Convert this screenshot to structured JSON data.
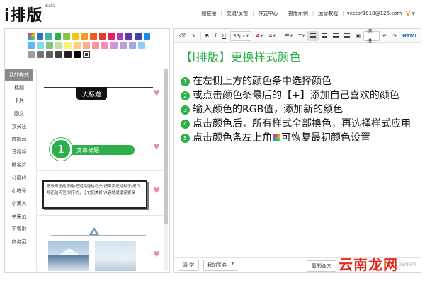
{
  "app": {
    "logo": "i排版",
    "beta": "Beta"
  },
  "topnav": {
    "items": [
      "超链接",
      "交流/反馈",
      "样式中心",
      "排版示例",
      "运营教程"
    ],
    "email": "vector1018@126.com",
    "vip_icon": "vip-badge-icon"
  },
  "palette": {
    "rows": [
      [
        "#2f6ec9",
        "#3fb5b0",
        "#2db04a",
        "#8bc34a",
        "#f5c518",
        "#f59c1a",
        "#ee5a24",
        "#e53935",
        "#e91e63",
        "#ad3bb5",
        "#5e35b1",
        "#3949ab",
        "#1e88e5"
      ],
      [
        "#64b5f6",
        "#80deea",
        "#81c784",
        "#c5e1a5",
        "#fff176",
        "#ffcc80",
        "#ffab91",
        "#ef9a9a",
        "#f48fb1",
        "#ce93d8",
        "#b39ddb",
        "#9fa8da",
        "#90caf9"
      ],
      [
        "#9e9e9e",
        "#757575",
        "#616161",
        "#424242",
        "#212121",
        "#000000"
      ]
    ]
  },
  "side_tabs": [
    "我的样式",
    "标题",
    "卡片",
    "图文",
    "顶关注",
    "底提示",
    "音视频",
    "微名片",
    "分隔线",
    "小符号",
    "小黄人",
    "苹果范",
    "下雪啦",
    "商务范"
  ],
  "styles": {
    "card1_title": "大标题",
    "card2_num": "1",
    "card2_title": "文章标题",
    "card3_text": "把歌声还给夜晚/把道路还给尽头/把果实还给种子/把飞翔还给天空/剩下的，让它们美好/从容地缓缓穿更深"
  },
  "toolbar": {
    "font_size": "36px",
    "tools": [
      "eraser-icon",
      "brush-icon",
      "B",
      "I",
      "U",
      "A",
      "A",
      "list-icon",
      "T",
      "align-left-icon",
      "align-center-icon",
      "align-right-icon",
      "align-justify-icon",
      "image-icon",
      "缩进",
      "undo-icon",
      "redo-icon",
      "HTML"
    ],
    "indent_label": "缩进",
    "html_label": "HTML"
  },
  "editor": {
    "heading": "【i排版】更换样式颜色",
    "steps": [
      {
        "num": "1",
        "text": "在左侧上方的颜色条中选择颜色"
      },
      {
        "num": "2",
        "text": "或点击颜色条最后的【+】添加自己喜欢的颜色"
      },
      {
        "num": "3",
        "text": "输入颜色的RGB值，添加新的颜色"
      },
      {
        "num": "4",
        "text": "点击颜色后，所有样式全部换色，再选择样式应用"
      },
      {
        "num": "5",
        "text_before": "点击颜色条左上角",
        "text_after": "可恢复最初颜色设置"
      }
    ]
  },
  "bottom": {
    "clear": "清 空",
    "signature": "我的签名",
    "copy": "复制全文",
    "counter": "23/9877"
  },
  "watermark": "云南龙网"
}
